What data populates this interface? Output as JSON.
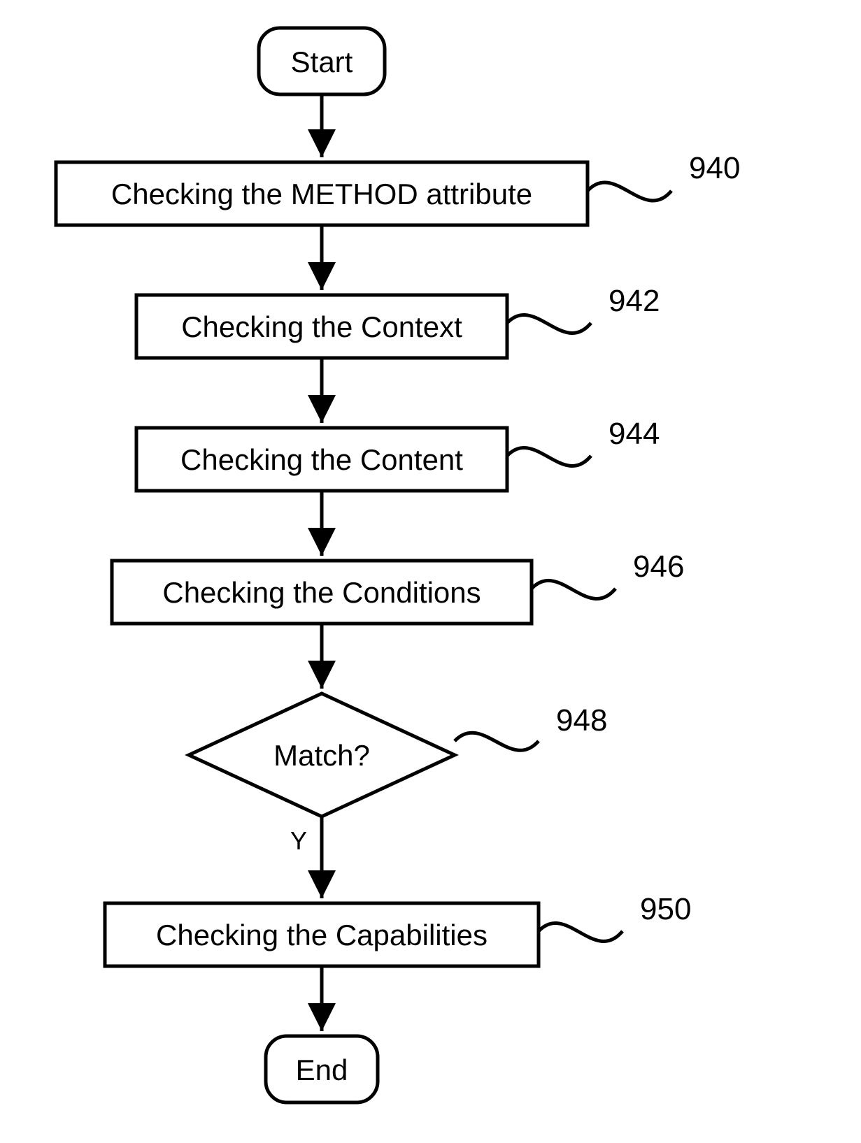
{
  "nodes": {
    "start": {
      "text": "Start"
    },
    "step1": {
      "text": "Checking the METHOD attribute",
      "label": "940"
    },
    "step2": {
      "text": "Checking the Context",
      "label": "942"
    },
    "step3": {
      "text": "Checking the Content",
      "label": "944"
    },
    "step4": {
      "text": "Checking the Conditions",
      "label": "946"
    },
    "decision": {
      "text": "Match?",
      "label": "948",
      "yes": "Y"
    },
    "step5": {
      "text": "Checking the Capabilities",
      "label": "950"
    },
    "end": {
      "text": "End"
    }
  }
}
